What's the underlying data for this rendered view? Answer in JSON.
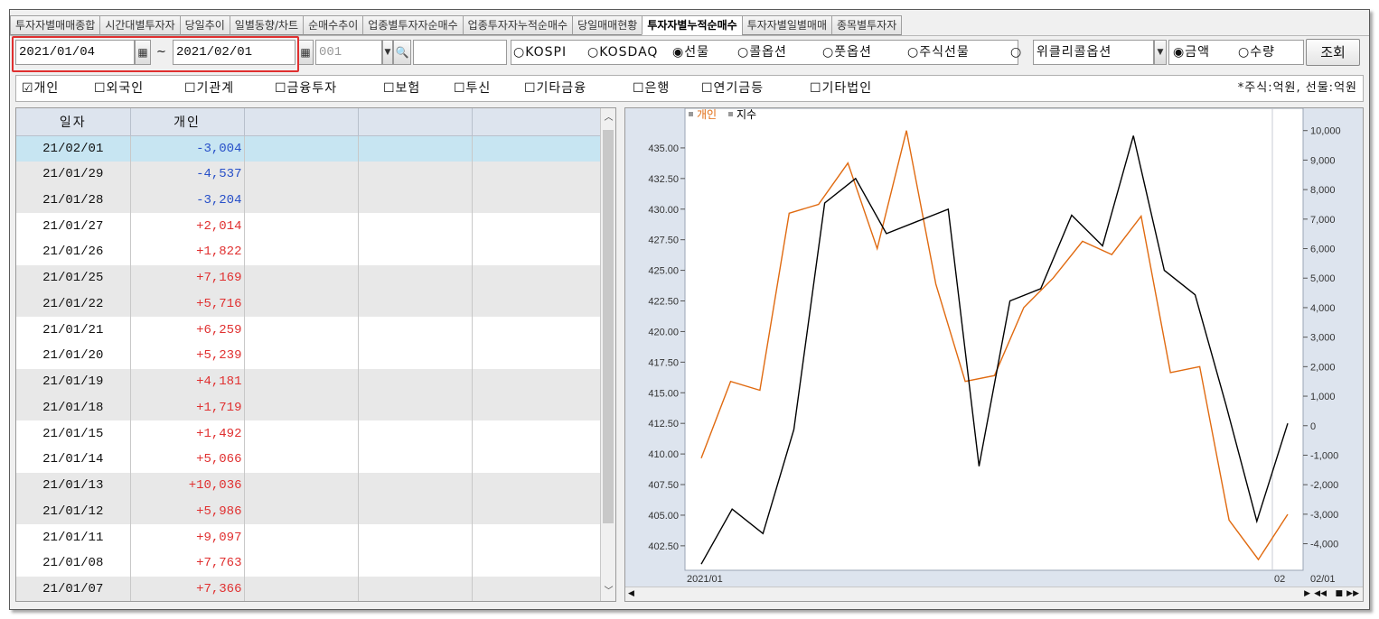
{
  "tabs": [
    {
      "label": "투자자별매매종합",
      "active": false
    },
    {
      "label": "시간대별투자자",
      "active": false
    },
    {
      "label": "당일추이",
      "active": false
    },
    {
      "label": "일별동향/차트",
      "active": false
    },
    {
      "label": "순매수추이",
      "active": false
    },
    {
      "label": "업종별투자자순매수",
      "active": false
    },
    {
      "label": "업종투자자누적순매수",
      "active": false
    },
    {
      "label": "당일매매현황",
      "active": false
    },
    {
      "label": "투자자별누적순매수",
      "active": true
    },
    {
      "label": "투자자별일별매매",
      "active": false
    },
    {
      "label": "종목별투자자",
      "active": false
    }
  ],
  "toolbar": {
    "start_date": "2021/01/04",
    "tilde": "~",
    "end_date": "2021/02/01",
    "code": "001",
    "market_options": [
      "○KOSPI",
      "○KOSDAQ",
      "◉선물",
      "○콜옵션",
      "○풋옵션",
      "○주식선물",
      "○"
    ],
    "weekly_option": "위클리콜옵션",
    "amount": "◉금액",
    "quantity": "○수량",
    "query_button": "조회"
  },
  "investors": [
    {
      "label": "☑개인"
    },
    {
      "label": "☐외국인"
    },
    {
      "label": "☐기관계"
    },
    {
      "label": "☐금융투자"
    },
    {
      "label": "☐보험"
    },
    {
      "label": "☐투신"
    },
    {
      "label": "☐기타금융"
    },
    {
      "label": "☐은행"
    },
    {
      "label": "☐연기금등"
    },
    {
      "label": "☐기타법인"
    }
  ],
  "unit_note": "*주식:억원, 선물:억원",
  "table": {
    "headers": [
      "일자",
      "개인",
      "",
      "",
      ""
    ],
    "rows": [
      {
        "date": "21/02/01",
        "value": "-3,004"
      },
      {
        "date": "21/01/29",
        "value": "-4,537"
      },
      {
        "date": "21/01/28",
        "value": "-3,204"
      },
      {
        "date": "21/01/27",
        "value": "+2,014"
      },
      {
        "date": "21/01/26",
        "value": "+1,822"
      },
      {
        "date": "21/01/25",
        "value": "+7,169"
      },
      {
        "date": "21/01/22",
        "value": "+5,716"
      },
      {
        "date": "21/01/21",
        "value": "+6,259"
      },
      {
        "date": "21/01/20",
        "value": "+5,239"
      },
      {
        "date": "21/01/19",
        "value": "+4,181"
      },
      {
        "date": "21/01/18",
        "value": "+1,719"
      },
      {
        "date": "21/01/15",
        "value": "+1,492"
      },
      {
        "date": "21/01/14",
        "value": "+5,066"
      },
      {
        "date": "21/01/13",
        "value": "+10,036"
      },
      {
        "date": "21/01/12",
        "value": "+5,986"
      },
      {
        "date": "21/01/11",
        "value": "+9,097"
      },
      {
        "date": "21/01/08",
        "value": "+7,763"
      },
      {
        "date": "21/01/07",
        "value": "+7,366"
      }
    ]
  },
  "chart_data": {
    "type": "line",
    "legend": [
      {
        "name": "개인",
        "color": "#e06a10"
      },
      {
        "name": "지수",
        "color": "#000000"
      }
    ],
    "left_axis": {
      "ticks": [
        "435.00",
        "432.50",
        "430.00",
        "427.50",
        "425.00",
        "422.50",
        "420.00",
        "417.50",
        "415.00",
        "412.50",
        "410.00",
        "407.50",
        "405.00",
        "402.50"
      ],
      "range": [
        400.5,
        437.5
      ]
    },
    "right_axis": {
      "ticks": [
        "10,000",
        "9,000",
        "8,000",
        "7,000",
        "6,000",
        "5,000",
        "4,000",
        "3,000",
        "2,000",
        "1,000",
        "0",
        "-1,000",
        "-2,000",
        "-3,000",
        "-4,000"
      ],
      "range": [
        -4900,
        10450
      ]
    },
    "x_labels": [
      "2021/01",
      "02",
      "02/01"
    ],
    "series": [
      {
        "name": "개인",
        "axis": "right",
        "color": "#e06a10",
        "values": [
          -1100,
          1500,
          1200,
          7200,
          7500,
          8900,
          6000,
          10000,
          4800,
          1500,
          1700,
          4000,
          5000,
          6250,
          5800,
          7100,
          1800,
          2000,
          -3200,
          -4537,
          -3004
        ]
      },
      {
        "name": "지수",
        "axis": "left",
        "color": "#000000",
        "values": [
          401.0,
          405.5,
          403.5,
          412.0,
          430.5,
          432.5,
          428.0,
          429.0,
          430.0,
          409.0,
          422.5,
          423.5,
          429.5,
          427.0,
          436.0,
          425.0,
          423.0,
          414.0,
          404.5,
          412.5
        ]
      }
    ]
  },
  "colors": {
    "positive": "#e03030",
    "negative": "#2850c8",
    "selected_row": "#c7e5f2",
    "highlight": "#e03030"
  }
}
